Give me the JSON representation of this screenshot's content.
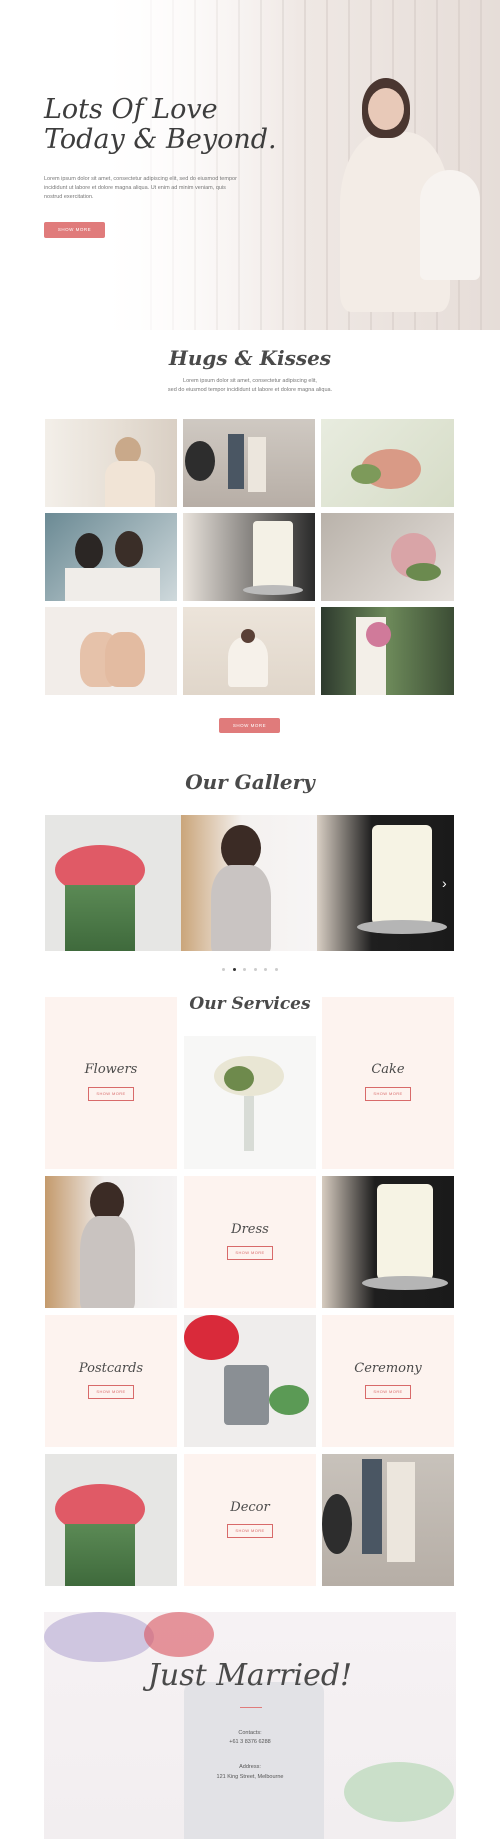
{
  "hero": {
    "title_line1": "Lots Of Love",
    "title_line2": "Today & Beyond.",
    "text": "Lorem ipsum dolor sit amet, consectetur adipiscing elit, sed do eiusmod tempor incididunt ut labore et dolore magna aliqua. Ut enim ad minim veniam, quis nostrud exercitation.",
    "button": "SHOW MORE"
  },
  "hugs": {
    "title": "Hugs & Kisses",
    "text_line1": "Lorem ipsum dolor sit amet, consectetur adipiscing elit,",
    "text_line2": "sed do eiusmod tempor incididunt ut labore et dolore magna aliqua.",
    "button": "SHOW MORE"
  },
  "gallery": {
    "title": "Our Gallery",
    "next_arrow": "›",
    "dot_count": 6,
    "active_dot": 1
  },
  "services": {
    "title": "Our Services",
    "items": [
      {
        "name": "Flowers",
        "button": "SHOW MORE"
      },
      {
        "name": "Cake",
        "button": "SHOW MORE"
      },
      {
        "name": "Dress",
        "button": "SHOW MORE"
      },
      {
        "name": "Postcards",
        "button": "SHOW MORE"
      },
      {
        "name": "Ceremony",
        "button": "SHOW MORE"
      },
      {
        "name": "Decor",
        "button": "SHOW MORE"
      }
    ]
  },
  "footer": {
    "title": "Just Married!",
    "contacts_label": "Contacts:",
    "phone": "+61 3 8376 6288",
    "address_label": "Address:",
    "address": "121 King Street, Melbourne"
  },
  "colors": {
    "accent": "#e07b7b",
    "service_bg": "#fdf3ef"
  }
}
